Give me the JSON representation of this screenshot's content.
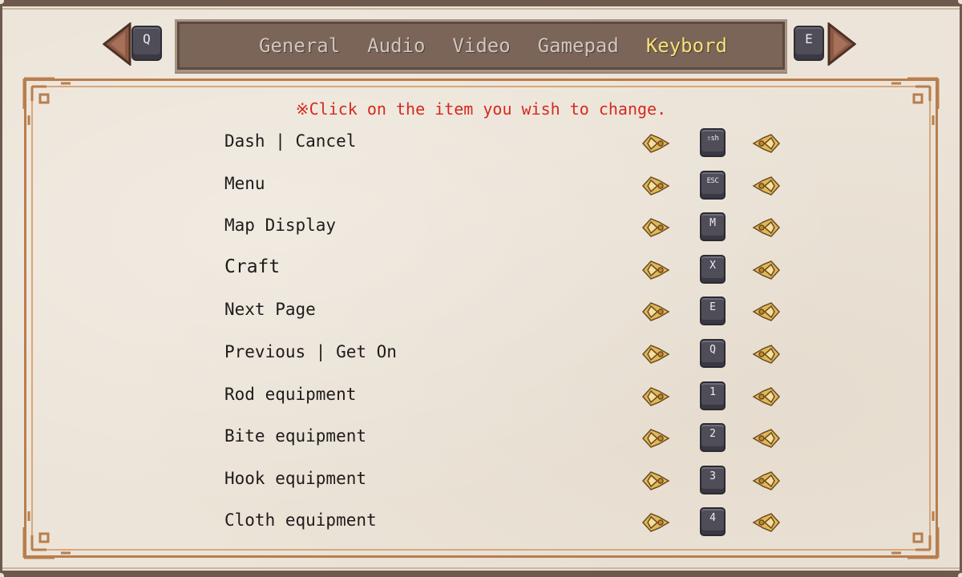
{
  "tabs": {
    "prev_key": "Q",
    "next_key": "E",
    "items": [
      {
        "label": "General"
      },
      {
        "label": "Audio"
      },
      {
        "label": "Video"
      },
      {
        "label": "Gamepad"
      },
      {
        "label": "Keybord"
      }
    ],
    "active": "Keybord"
  },
  "instruction": "※Click on the item you wish to change.",
  "bindings": [
    {
      "action": "Dash | Cancel",
      "key": "⇧sh"
    },
    {
      "action": "Menu",
      "key": "ESC"
    },
    {
      "action": "Map Display",
      "key": "M"
    },
    {
      "action": "Craft",
      "key": "X"
    },
    {
      "action": "Next Page",
      "key": "E"
    },
    {
      "action": "Previous | Get On",
      "key": "Q"
    },
    {
      "action": "Rod equipment",
      "key": "1"
    },
    {
      "action": "Bite equipment",
      "key": "2"
    },
    {
      "action": "Hook equipment",
      "key": "3"
    },
    {
      "action": "Cloth equipment",
      "key": "4"
    }
  ],
  "colors": {
    "tab_active": "#f6e07a",
    "tab_inactive": "#cfc6bf",
    "instruction": "#d42a1e",
    "frame": "#b87e4e",
    "keycap": "#4f4d58"
  }
}
